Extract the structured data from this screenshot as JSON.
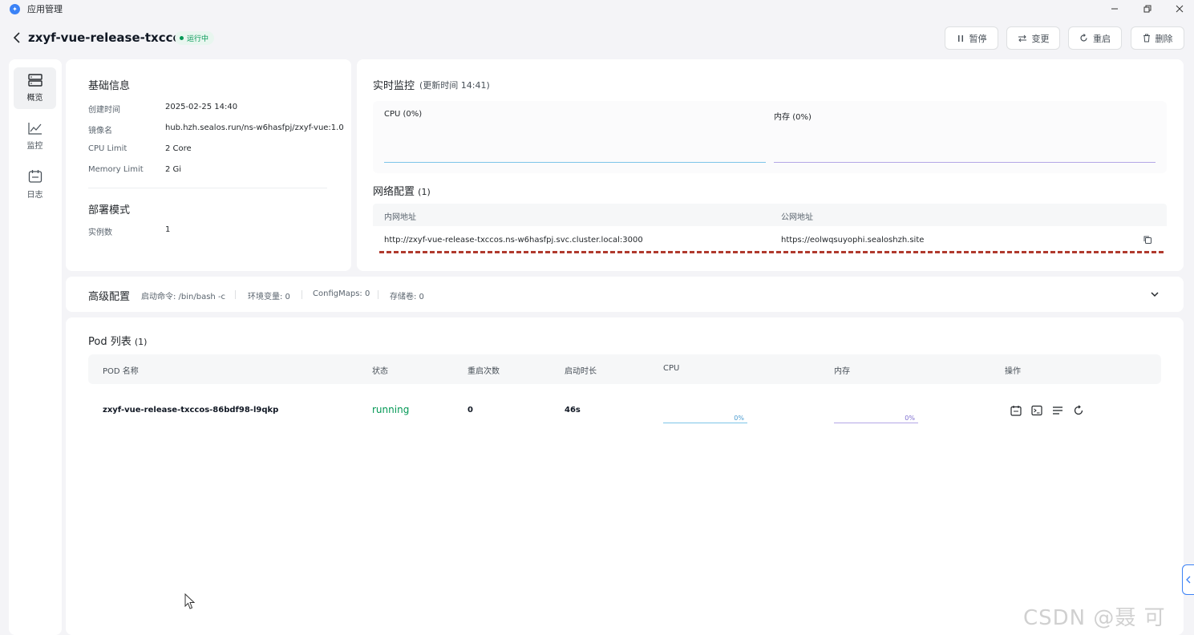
{
  "window": {
    "title": "应用管理",
    "controls": [
      "minimize",
      "restore",
      "close"
    ]
  },
  "header": {
    "app_name": "zxyf-vue-release-txccos",
    "status": "运行中",
    "buttons": {
      "pause": "暂停",
      "change": "变更",
      "restart": "重启",
      "delete": "删除"
    }
  },
  "sidenav": {
    "items": [
      {
        "label": "概览",
        "icon": "server-icon",
        "active": true
      },
      {
        "label": "监控",
        "icon": "chart-icon",
        "active": false
      },
      {
        "label": "日志",
        "icon": "calendar-icon",
        "active": false
      }
    ]
  },
  "basic_info": {
    "title": "基础信息",
    "rows": [
      {
        "label": "创建时间",
        "value": "2025-02-25 14:40"
      },
      {
        "label": "镜像名",
        "value": "hub.hzh.sealos.run/ns-w6hasfpj/zxyf-vue:1.0"
      },
      {
        "label": "CPU Limit",
        "value": "2 Core"
      },
      {
        "label": "Memory Limit",
        "value": "2 Gi"
      }
    ],
    "deploy_title": "部署模式",
    "deploy_rows": [
      {
        "label": "实例数",
        "value": "1"
      }
    ]
  },
  "monitor": {
    "title": "实时监控",
    "update_time": "(更新时间  14:41)",
    "cpu_label": "CPU",
    "cpu_value": "(0%)",
    "mem_label": "内存",
    "mem_value": "(0%)",
    "cpu_color": "#7dc5e8",
    "mem_color": "#b4a6e6"
  },
  "network": {
    "title": "网络配置",
    "count": "(1)",
    "col_internal": "内网地址",
    "col_public": "公网地址",
    "internal_url": "http://zxyf-vue-release-txccos.ns-w6hasfpj.svc.cluster.local:3000",
    "public_url": "https://eolwqsuyophi.sealoshzh.site"
  },
  "advanced": {
    "title": "高级配置",
    "start_cmd": "启动命令: /bin/bash -c",
    "env": "环境变量: 0",
    "configmaps": "ConfigMaps: 0",
    "storage": "存储卷: 0"
  },
  "pods": {
    "title": "Pod 列表",
    "count": "(1)",
    "columns": [
      "POD 名称",
      "状态",
      "重启次数",
      "启动时长",
      "CPU",
      "内存",
      "操作"
    ],
    "rows": [
      {
        "name": "zxyf-vue-release-txccos-86bdf98-l9qkp",
        "status": "running",
        "restarts": "0",
        "uptime": "46s",
        "cpu": "0%",
        "mem": "0%"
      }
    ]
  },
  "watermark": "CSDN @聂 可 以"
}
